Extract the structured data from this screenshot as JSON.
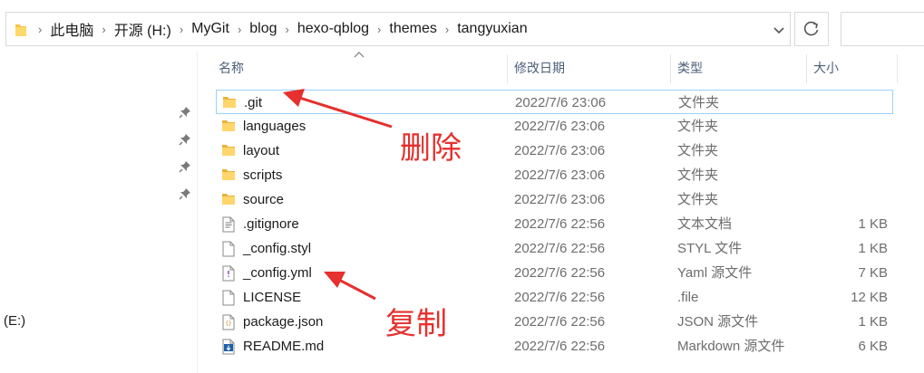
{
  "address_bar": {
    "crumbs": [
      "此电脑",
      "开源 (H:)",
      "MyGit",
      "blog",
      "hexo-qblog",
      "themes",
      "tangyuxian"
    ]
  },
  "nav": {
    "drive_label": "(E:)"
  },
  "columns": {
    "name": "名称",
    "date": "修改日期",
    "type": "类型",
    "size": "大小"
  },
  "files": [
    {
      "name": ".git",
      "date": "2022/7/6 23:06",
      "type": "文件夹",
      "size": "",
      "icon": "folder-icon",
      "selected": true
    },
    {
      "name": "languages",
      "date": "2022/7/6 23:06",
      "type": "文件夹",
      "size": "",
      "icon": "folder-icon"
    },
    {
      "name": "layout",
      "date": "2022/7/6 23:06",
      "type": "文件夹",
      "size": "",
      "icon": "folder-icon"
    },
    {
      "name": "scripts",
      "date": "2022/7/6 23:06",
      "type": "文件夹",
      "size": "",
      "icon": "folder-icon"
    },
    {
      "name": "source",
      "date": "2022/7/6 23:06",
      "type": "文件夹",
      "size": "",
      "icon": "folder-icon"
    },
    {
      "name": ".gitignore",
      "date": "2022/7/6 22:56",
      "type": "文本文档",
      "size": "1 KB",
      "icon": "text-file-icon"
    },
    {
      "name": "_config.styl",
      "date": "2022/7/6 22:56",
      "type": "STYL 文件",
      "size": "1 KB",
      "icon": "blank-file-icon"
    },
    {
      "name": "_config.yml",
      "date": "2022/7/6 22:56",
      "type": "Yaml 源文件",
      "size": "7 KB",
      "icon": "yaml-file-icon"
    },
    {
      "name": "LICENSE",
      "date": "2022/7/6 22:56",
      "type": ".file",
      "size": "12 KB",
      "icon": "blank-file-icon"
    },
    {
      "name": "package.json",
      "date": "2022/7/6 22:56",
      "type": "JSON 源文件",
      "size": "1 KB",
      "icon": "json-file-icon"
    },
    {
      "name": "README.md",
      "date": "2022/7/6 22:56",
      "type": "Markdown 源文件",
      "size": "6 KB",
      "icon": "markdown-file-icon"
    }
  ],
  "annotations": {
    "delete_label": "删除",
    "copy_label": "复制",
    "color": "#e5302d"
  },
  "colors": {
    "folder": "#f6c34a",
    "header_text": "#4c607a",
    "selection_border": "#99d1ff"
  }
}
